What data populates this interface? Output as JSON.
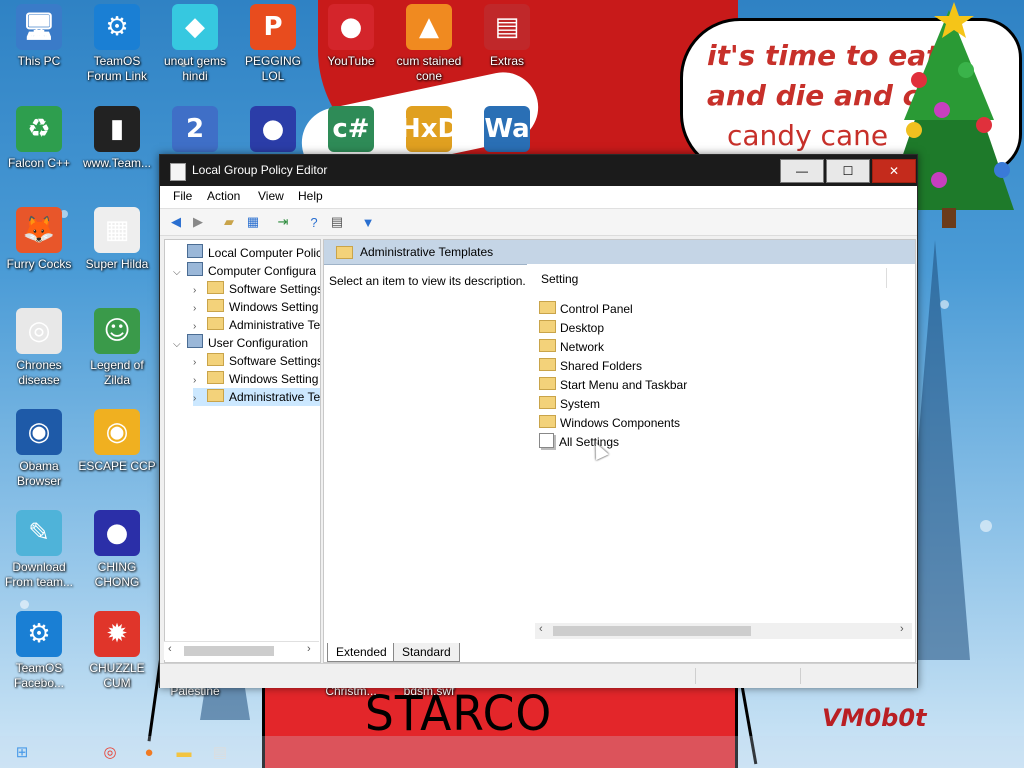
{
  "desktop": {
    "icons": [
      {
        "name": "this-pc",
        "label": "This PC",
        "glyph": "🖥",
        "bg": "#3a7bc8"
      },
      {
        "name": "teamos-forum-link",
        "label": "TeamOS Forum Link",
        "glyph": "⚙",
        "bg": "#1a7fd4"
      },
      {
        "name": "uncut-gems-hindi",
        "label": "uncut gems hindi",
        "glyph": "◆",
        "bg": "#36c8e0"
      },
      {
        "name": "pegging-lol",
        "label": "PEGGING LOL",
        "glyph": "P",
        "bg": "#e84c1e"
      },
      {
        "name": "youtube",
        "label": "YouTube",
        "glyph": "●",
        "bg": "#d4252b"
      },
      {
        "name": "cum-stained-cone",
        "label": "cum stained cone",
        "glyph": "▲",
        "bg": "#f08a20"
      },
      {
        "name": "extras",
        "label": "Extras",
        "glyph": "▤",
        "bg": "#c0282a"
      },
      {
        "name": "falcon-cpp",
        "label": "Falcon C++",
        "glyph": "♻",
        "bg": "#2e9e4e"
      },
      {
        "name": "www-team",
        "label": "www.Team...",
        "glyph": "▮",
        "bg": "#222222"
      },
      {
        "name": "number-2",
        "label": "",
        "glyph": "2",
        "bg": "#3f6fc7"
      },
      {
        "name": "ornament-blue",
        "label": "",
        "glyph": "●",
        "bg": "#2b3da8"
      },
      {
        "name": "csharp-tool",
        "label": "",
        "glyph": "c#",
        "bg": "#2e8b57"
      },
      {
        "name": "hxd",
        "label": "",
        "glyph": "HxD",
        "bg": "#e0a020"
      },
      {
        "name": "wa-tool",
        "label": "",
        "glyph": "Wa",
        "bg": "#2a6fb5"
      },
      {
        "name": "furry-cocks",
        "label": "Furry Cocks",
        "glyph": "🦊",
        "bg": "#e8562a"
      },
      {
        "name": "super-hilda",
        "label": "Super Hilda",
        "glyph": "▦",
        "bg": "#eeeeee"
      },
      {
        "name": "chrome-disease",
        "label": "Chrones disease",
        "glyph": "◎",
        "bg": "#e8e8e8"
      },
      {
        "name": "legend-of-zilda",
        "label": "Legend of Zilda",
        "glyph": "☺",
        "bg": "#3a9a4a"
      },
      {
        "name": "obama-browser",
        "label": "Obama Browser",
        "glyph": "◉",
        "bg": "#1e5aa8"
      },
      {
        "name": "escape-ccp",
        "label": "ESCAPE CCP",
        "glyph": "◉",
        "bg": "#f0b020"
      },
      {
        "name": "download-from-team",
        "label": "Download From team...",
        "glyph": "✎",
        "bg": "#4fb3d9"
      },
      {
        "name": "ching-chong",
        "label": "CHING CHONG",
        "glyph": "●",
        "bg": "#2b2fa8"
      },
      {
        "name": "teamos-facebook",
        "label": "TeamOS Facebo...",
        "glyph": "⚙",
        "bg": "#1a7fd4"
      },
      {
        "name": "chuzzle-cum",
        "label": "CHUZZLE CUM",
        "glyph": "✹",
        "bg": "#e0352a"
      }
    ],
    "partial_labels": [
      "Palestine",
      "Christm...",
      "bdsm.swf"
    ],
    "bubble_lines": [
      "it's time to eat",
      "and die and cl",
      "candy cane"
    ],
    "starco_text": "STARCO",
    "vm_mark": "VM0b0t"
  },
  "window": {
    "title": "Local Group Policy Editor",
    "buttons": {
      "minimize": "—",
      "maximize": "☐",
      "close": "✕"
    },
    "menu": [
      "File",
      "Action",
      "View",
      "Help"
    ],
    "tree": [
      {
        "label": "Local Computer Policy",
        "level": 0,
        "arrow": "",
        "icon": "doc"
      },
      {
        "label": "Computer Configura",
        "level": 1,
        "arrow": "⌵",
        "icon": "pc"
      },
      {
        "label": "Software Settings",
        "level": 2,
        "arrow": "›",
        "icon": "folder"
      },
      {
        "label": "Windows Setting",
        "level": 2,
        "arrow": "›",
        "icon": "folder"
      },
      {
        "label": "Administrative Te",
        "level": 2,
        "arrow": "›",
        "icon": "folder"
      },
      {
        "label": "User Configuration",
        "level": 1,
        "arrow": "⌵",
        "icon": "user"
      },
      {
        "label": "Software Settings",
        "level": 2,
        "arrow": "›",
        "icon": "folder"
      },
      {
        "label": "Windows Setting",
        "level": 2,
        "arrow": "›",
        "icon": "folder"
      },
      {
        "label": "Administrative Te",
        "level": 2,
        "arrow": "›",
        "icon": "folder",
        "selected": true
      }
    ],
    "right_header": "Administrative Templates",
    "description": "Select an item to view its description.",
    "column_header": "Setting",
    "items": [
      {
        "label": "Control Panel",
        "icon": "folder"
      },
      {
        "label": "Desktop",
        "icon": "folder"
      },
      {
        "label": "Network",
        "icon": "folder"
      },
      {
        "label": "Shared Folders",
        "icon": "folder"
      },
      {
        "label": "Start Menu and Taskbar",
        "icon": "folder"
      },
      {
        "label": "System",
        "icon": "folder"
      },
      {
        "label": "Windows Components",
        "icon": "folder"
      },
      {
        "label": "All Settings",
        "icon": "settings"
      }
    ],
    "tabs": [
      "Extended",
      "Standard"
    ],
    "active_tab": "Extended"
  },
  "taskbar": {
    "items": [
      {
        "name": "start",
        "glyph": "⊞",
        "color": "#4a9be8"
      },
      {
        "name": "chrome",
        "glyph": "◎",
        "color": "#e94235"
      },
      {
        "name": "firefox",
        "glyph": "●",
        "color": "#f07a22"
      },
      {
        "name": "explorer",
        "glyph": "▬",
        "color": "#f3c440"
      },
      {
        "name": "gpedit",
        "glyph": "▤",
        "color": "#dddddd"
      }
    ]
  }
}
